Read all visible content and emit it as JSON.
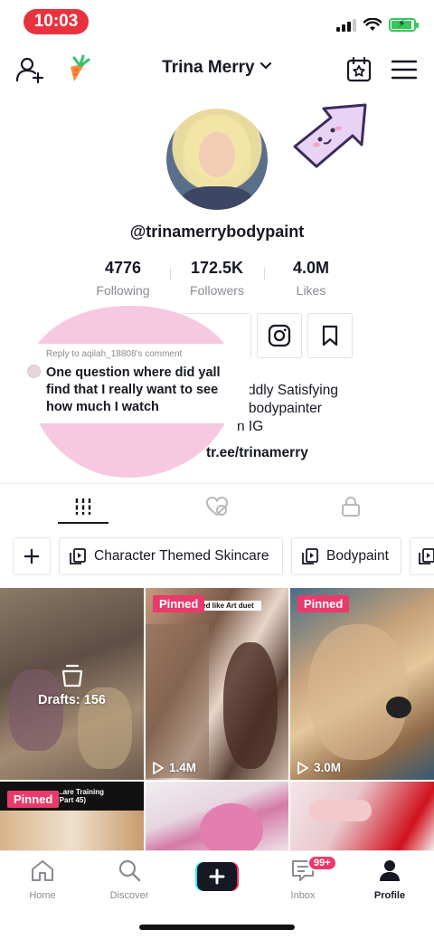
{
  "status_bar": {
    "time": "10:03"
  },
  "header": {
    "profile_name": "Trina Merry"
  },
  "profile": {
    "username": "@trinamerrybodypaint",
    "stats": [
      {
        "value": "4776",
        "label": "Following"
      },
      {
        "value": "172.5K",
        "label": "Followers"
      },
      {
        "value": "4.0M",
        "label": "Likes"
      }
    ],
    "bio_lines": [
      "Oddly Satisfying",
      "n bodypainter",
      "n IG"
    ],
    "link": "tr.ee/trinamerry"
  },
  "reply_overlay": {
    "meta": "Reply to aqilah_18808's comment",
    "text": "One question where did yall find that I really want to see how much I watch"
  },
  "playlists": [
    "Character Themed Skincare",
    "Bodypaint"
  ],
  "videos": [
    {
      "drafts": "Drafts: 156"
    },
    {
      "badge": "Pinned",
      "views": "1.4M",
      "caption": "...ked like Art duet"
    },
    {
      "badge": "Pinned",
      "views": "3.0M"
    },
    {
      "badge": "Pinned",
      "caption": "...are Training (Part 45)"
    },
    {},
    {}
  ],
  "bottom_nav": {
    "home": "Home",
    "discover": "Discover",
    "inbox": "Inbox",
    "inbox_badge": "99+",
    "profile": "Profile"
  },
  "colors": {
    "accent": "#ea3a6c",
    "time_pill": "#e8333e",
    "blob": "#f6c9e1"
  }
}
